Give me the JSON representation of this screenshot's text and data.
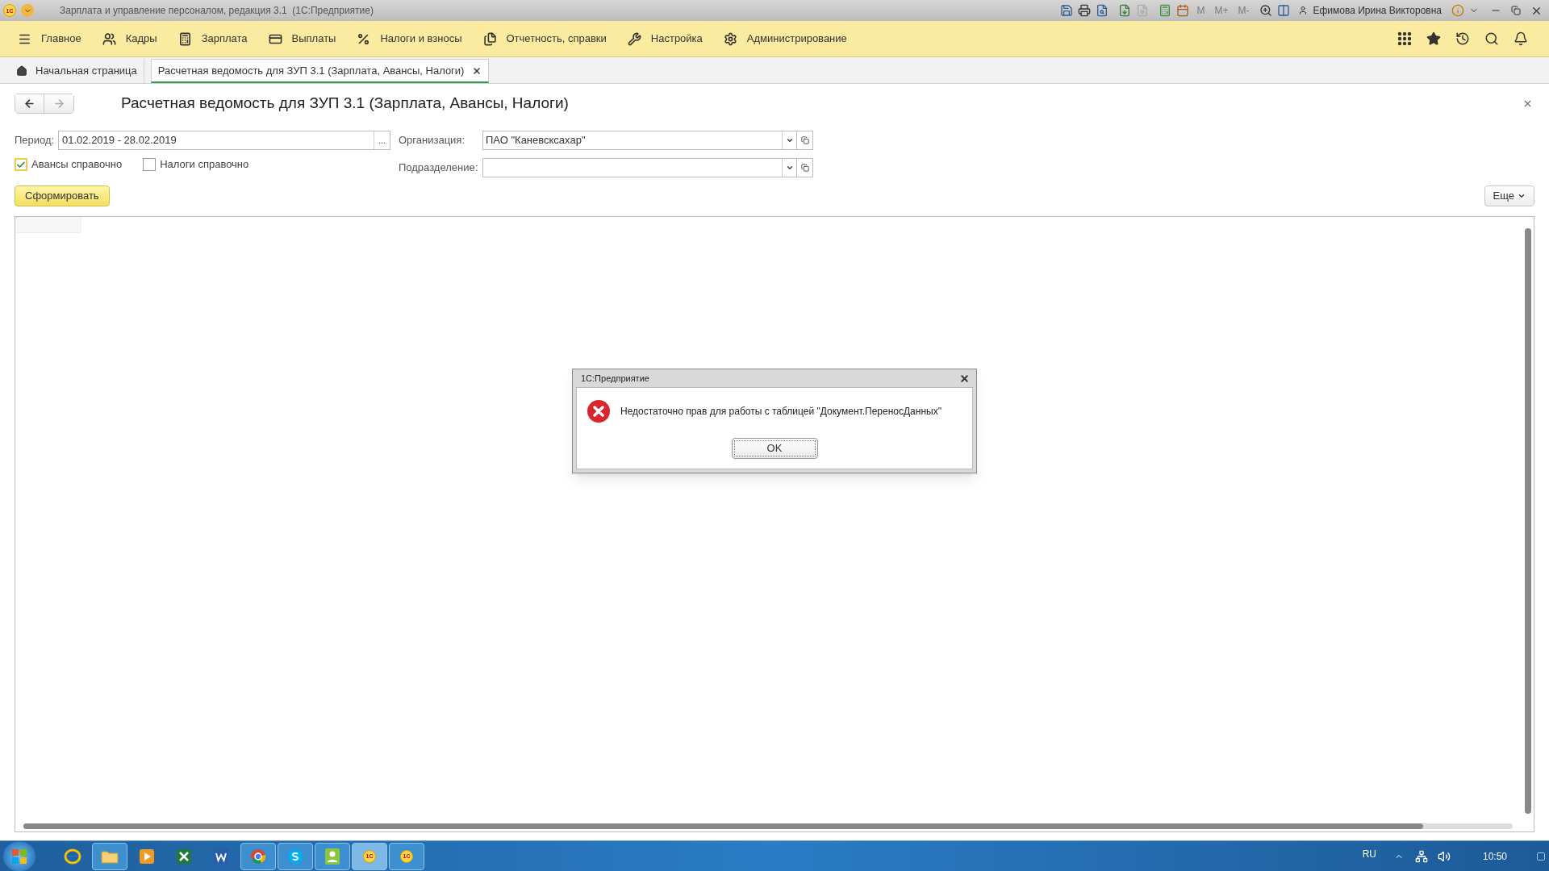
{
  "window": {
    "logo": "1С",
    "title": "Зарплата и управление персоналом, редакция 3.1  (1С:Предприятие)",
    "memory_buttons": [
      {
        "label": "M",
        "disabled": true
      },
      {
        "label": "M+",
        "disabled": true
      },
      {
        "label": "M-",
        "disabled": true
      }
    ],
    "user": "Ефимова Ирина Викторовна"
  },
  "sections": [
    {
      "label": "Главное"
    },
    {
      "label": "Кадры"
    },
    {
      "label": "Зарплата"
    },
    {
      "label": "Выплаты"
    },
    {
      "label": "Налоги и взносы"
    },
    {
      "label": "Отчетность, справки"
    },
    {
      "label": "Настройка"
    },
    {
      "label": "Администрирование"
    }
  ],
  "tabs": [
    {
      "kind": "home",
      "label": "Начальная страница",
      "selected": false
    },
    {
      "kind": "document",
      "label": "Расчетная ведомость для ЗУП 3.1 (Зарплата, Авансы, Налоги)",
      "selected": true
    }
  ],
  "form": {
    "title": "Расчетная ведомость для ЗУП 3.1 (Зарплата, Авансы, Налоги)",
    "forward_disabled": true,
    "period": {
      "label": "Период:",
      "value": "01.02.2019 - 28.02.2019",
      "button": "..."
    },
    "organization": {
      "label": "Организация:",
      "value": "ПАО \"Каневсксахар\""
    },
    "subdivision": {
      "label": "Подразделение:"
    },
    "checkboxes": [
      {
        "label": "Авансы справочно",
        "checked": true
      },
      {
        "label": "Налоги справочно",
        "checked": false
      }
    ],
    "generate_button": "Сформировать",
    "more_button": "Еще"
  },
  "dialog": {
    "title": "1С:Предприятие",
    "message": "Недостаточно прав для работы с таблицей \"Документ.ПереносДанных\"",
    "ok_button": "OK"
  },
  "taskbar": {
    "apps": [
      {
        "kind": "browser",
        "running": false,
        "selected": false
      },
      {
        "kind": "folder",
        "running": true,
        "selected": false
      },
      {
        "kind": "media",
        "running": false,
        "selected": false
      },
      {
        "kind": "spreadsheet",
        "running": false,
        "selected": false
      },
      {
        "kind": "writer",
        "running": false,
        "selected": false
      },
      {
        "kind": "chrome",
        "running": true,
        "selected": false
      },
      {
        "kind": "messenger",
        "running": true,
        "selected": false
      },
      {
        "kind": "contact",
        "running": true,
        "selected": false
      },
      {
        "kind": "logo",
        "label": "1С",
        "running": true,
        "selected": true
      },
      {
        "kind": "logo",
        "label": "1С",
        "running": true,
        "selected": false
      }
    ],
    "language": "RU",
    "time": "10:50"
  }
}
